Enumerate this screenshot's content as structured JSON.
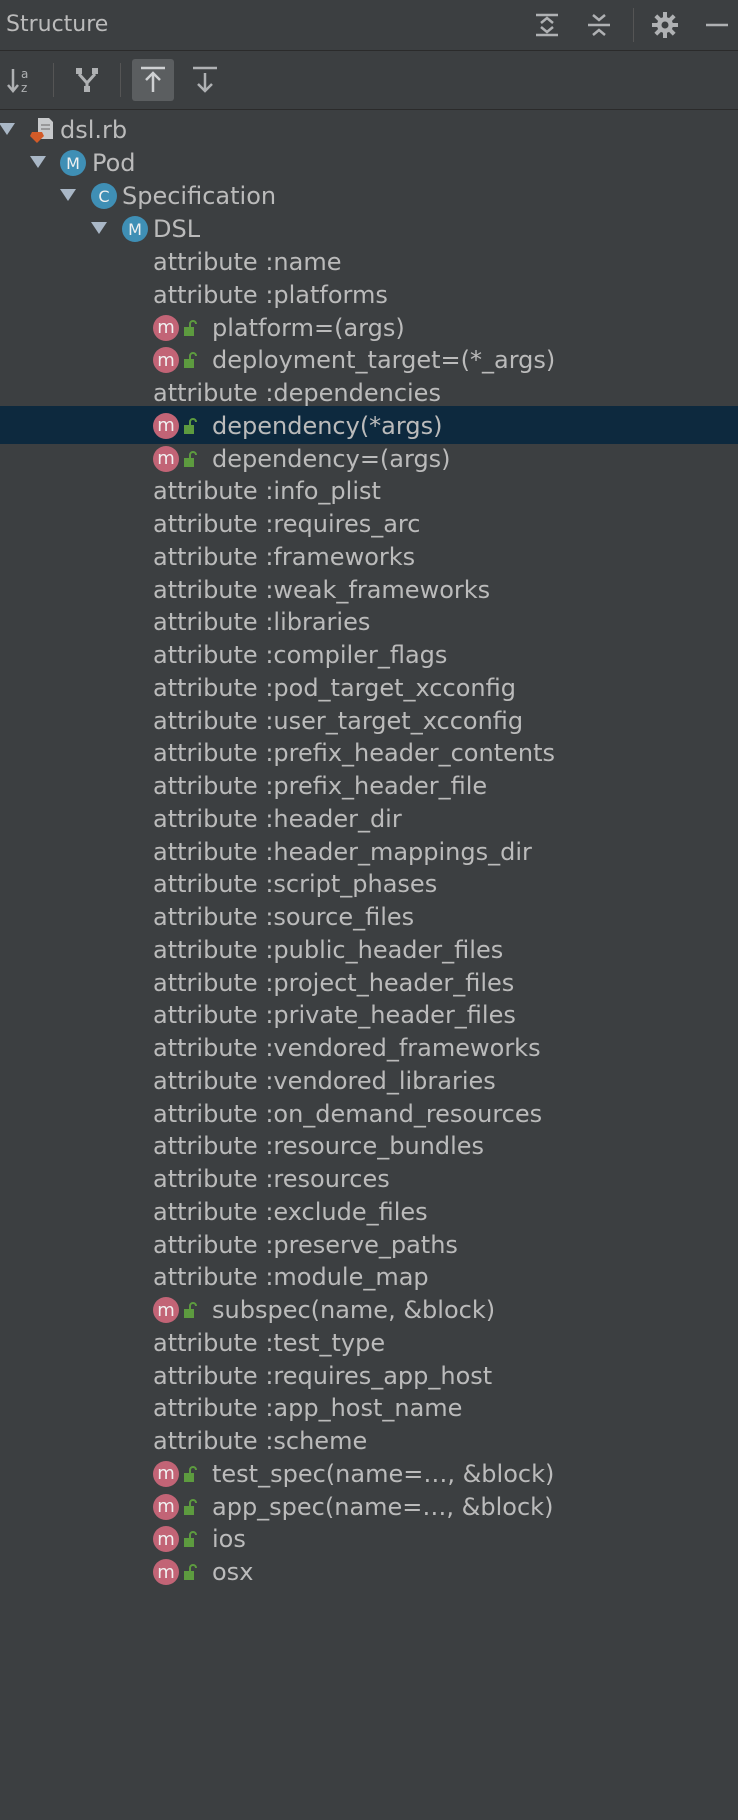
{
  "panel": {
    "title": "Structure"
  },
  "header": {
    "buttons": [
      {
        "name": "expand-all",
        "icon": "expand-all-icon"
      },
      {
        "name": "collapse-all",
        "icon": "collapse-all-icon"
      },
      {
        "name": "settings",
        "icon": "gear-icon"
      },
      {
        "name": "hide",
        "icon": "minimize-icon"
      }
    ]
  },
  "toolbar": {
    "buttons": [
      {
        "name": "sort-alpha",
        "icon": "sort-alphabetically-icon",
        "active": false
      },
      {
        "name": "show-inherited",
        "icon": "inherited-icon",
        "active": false
      },
      {
        "name": "autoscroll-to-source",
        "icon": "autoscroll-to-source-icon",
        "active": true
      },
      {
        "name": "autoscroll-from-source",
        "icon": "autoscroll-from-source-icon",
        "active": false
      }
    ]
  },
  "tree": {
    "root": {
      "label": "dsl.rb",
      "icon": "ruby-file-icon"
    },
    "pod": {
      "label": "Pod",
      "badge": "M"
    },
    "specification": {
      "label": "Specification",
      "badge": "C"
    },
    "dsl": {
      "label": "DSL",
      "badge": "M"
    },
    "method_badge": "m",
    "items": [
      {
        "kind": "attr",
        "label": "attribute :name"
      },
      {
        "kind": "attr",
        "label": "attribute :platforms"
      },
      {
        "kind": "method",
        "label": "platform=(args)"
      },
      {
        "kind": "method",
        "label": "deployment_target=(*_args)"
      },
      {
        "kind": "attr",
        "label": "attribute :dependencies"
      },
      {
        "kind": "method",
        "label": "dependency(*args)",
        "selected": true
      },
      {
        "kind": "method",
        "label": "dependency=(args)"
      },
      {
        "kind": "attr",
        "label": "attribute :info_plist"
      },
      {
        "kind": "attr",
        "label": "attribute :requires_arc"
      },
      {
        "kind": "attr",
        "label": "attribute :frameworks"
      },
      {
        "kind": "attr",
        "label": "attribute :weak_frameworks"
      },
      {
        "kind": "attr",
        "label": "attribute :libraries"
      },
      {
        "kind": "attr",
        "label": "attribute :compiler_flags"
      },
      {
        "kind": "attr",
        "label": "attribute :pod_target_xcconfig"
      },
      {
        "kind": "attr",
        "label": "attribute :user_target_xcconfig"
      },
      {
        "kind": "attr",
        "label": "attribute :prefix_header_contents"
      },
      {
        "kind": "attr",
        "label": "attribute :prefix_header_file"
      },
      {
        "kind": "attr",
        "label": "attribute :header_dir"
      },
      {
        "kind": "attr",
        "label": "attribute :header_mappings_dir"
      },
      {
        "kind": "attr",
        "label": "attribute :script_phases"
      },
      {
        "kind": "attr",
        "label": "attribute :source_files"
      },
      {
        "kind": "attr",
        "label": "attribute :public_header_files"
      },
      {
        "kind": "attr",
        "label": "attribute :project_header_files"
      },
      {
        "kind": "attr",
        "label": "attribute :private_header_files"
      },
      {
        "kind": "attr",
        "label": "attribute :vendored_frameworks"
      },
      {
        "kind": "attr",
        "label": "attribute :vendored_libraries"
      },
      {
        "kind": "attr",
        "label": "attribute :on_demand_resources"
      },
      {
        "kind": "attr",
        "label": "attribute :resource_bundles"
      },
      {
        "kind": "attr",
        "label": "attribute :resources"
      },
      {
        "kind": "attr",
        "label": "attribute :exclude_files"
      },
      {
        "kind": "attr",
        "label": "attribute :preserve_paths"
      },
      {
        "kind": "attr",
        "label": "attribute :module_map"
      },
      {
        "kind": "method",
        "label": "subspec(name, &block)"
      },
      {
        "kind": "attr",
        "label": "attribute :test_type"
      },
      {
        "kind": "attr",
        "label": "attribute :requires_app_host"
      },
      {
        "kind": "attr",
        "label": "attribute :app_host_name"
      },
      {
        "kind": "attr",
        "label": "attribute :scheme"
      },
      {
        "kind": "method",
        "label": "test_spec(name=…, &block)"
      },
      {
        "kind": "method",
        "label": "app_spec(name=…, &block)"
      },
      {
        "kind": "method",
        "label": "ios"
      },
      {
        "kind": "method",
        "label": "osx"
      }
    ]
  },
  "colors": {
    "background": "#3c3f41",
    "selection": "#0d293e",
    "module_badge": "#3f8fb5",
    "method_badge": "#c26476",
    "lock": "#5d9b3f",
    "ruby_file": "#d25b28"
  }
}
